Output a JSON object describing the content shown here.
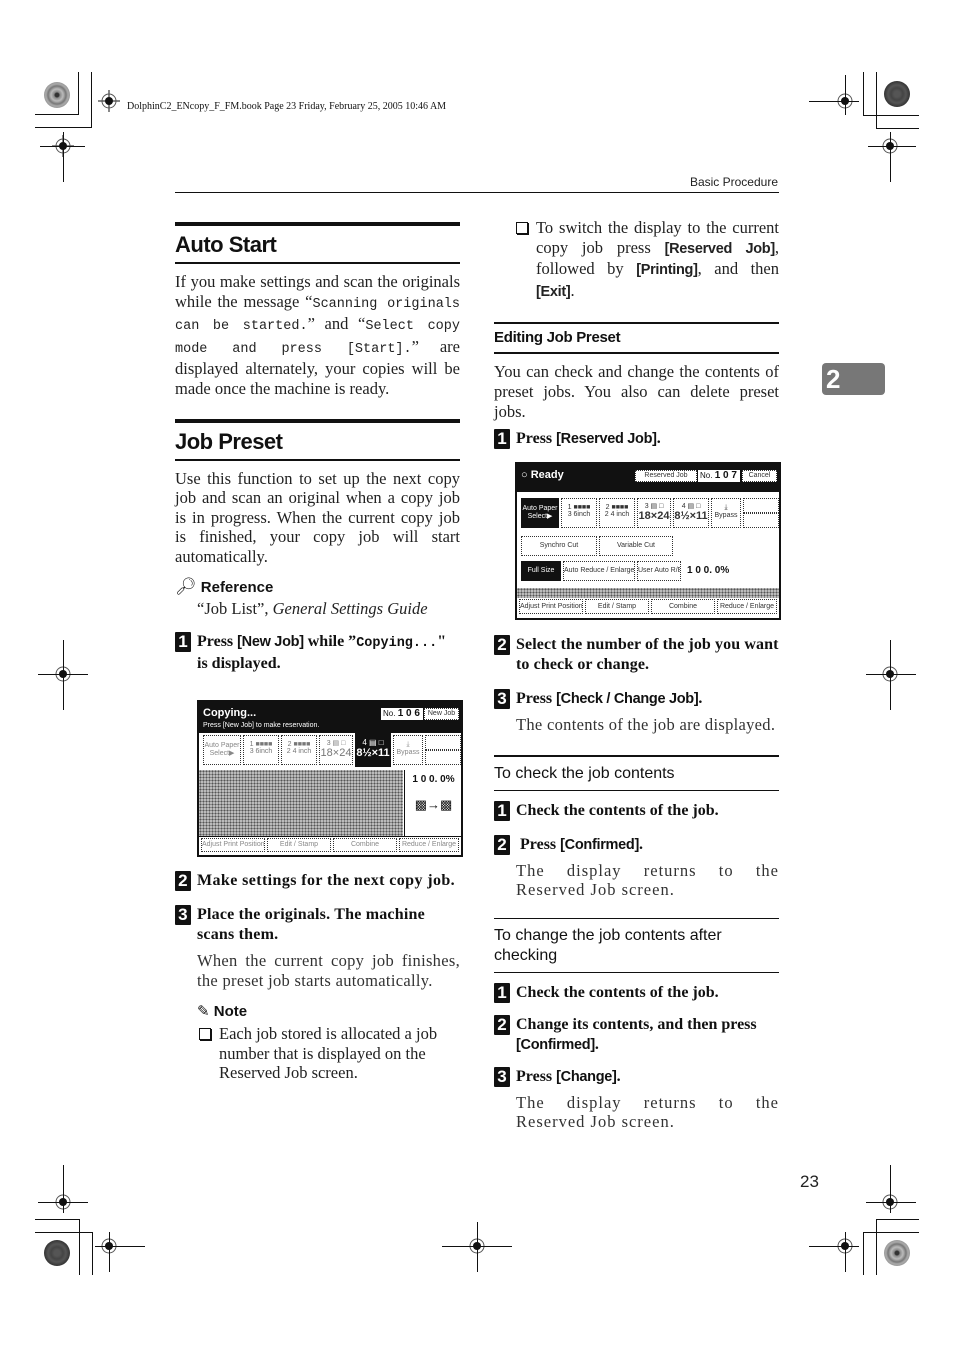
{
  "print_marks": {
    "book_info": "DolphinC2_ENcopy_F_FM.book  Page 23  Friday, February 25, 2005  10:46 AM"
  },
  "header": {
    "running_head": "Basic Procedure"
  },
  "chapter_tab": "2",
  "page_number": "23",
  "left_column": {
    "auto_start": {
      "title": "Auto Start",
      "body_1": "If you make settings and scan the originals while the message “",
      "msg_1": "Scanning originals can be started.",
      "body_2": "” and “",
      "msg_2": "Select copy mode and press [Start].",
      "body_3": "” are displayed alternately, your copies will be made once the machine is ready."
    },
    "job_preset": {
      "title": "Job Preset",
      "body": "Use this function to set up the next copy job and scan an original when a copy job is in progress. When the current copy job is finished, your copy job will start automatically.",
      "reference_label": "Reference",
      "reference_text_1": "“Job List”, ",
      "reference_text_2": "General Settings Guide",
      "steps": [
        {
          "num": "1",
          "pre": "Press ",
          "key": "[New Job]",
          "mid": " while ”",
          "mono": "Copying...",
          "post": "\" is displayed."
        },
        {
          "num": "2",
          "text": "Make settings for the next copy job."
        },
        {
          "num": "3",
          "text": "Place the originals. The machine scans them.",
          "sub": "When the current copy job finishes, the preset job starts automatically."
        }
      ],
      "note_label": "Note",
      "note_item": "Each job stored is allocated a job number that is displayed on the Reserved Job screen."
    },
    "screen_copying": {
      "status": "Copying...",
      "message": "Press [New Job] to make reservation.",
      "job_no_label": "No.",
      "job_no": "1 0 6",
      "new_job_button": "New Job",
      "paper_buttons": [
        {
          "line1": "Auto Paper",
          "line2": "Select▶"
        },
        {
          "line1": "1 ■■■■",
          "line2": "3 6inch"
        },
        {
          "line1": "2 ■■■■",
          "line2": "2 4 inch"
        },
        {
          "line1": "3 ▤ □",
          "line2": "18×24"
        },
        {
          "line1": "4 ▤ □",
          "line2": "8½×11"
        },
        {
          "line1": "⤓",
          "line2": "Bypass"
        }
      ],
      "ratio": "1 0 0. 0%",
      "bottom_buttons": [
        "Adjust Print Position",
        "Edit / Stamp",
        "Combine",
        "Reduce / Enlarge"
      ]
    }
  },
  "right_column": {
    "tip": {
      "pre": "To switch the display to the current copy job press ",
      "key1": "[Reserved Job]",
      "mid1": ", followed by ",
      "key2": "[Printing]",
      "mid2": ", and then ",
      "key3": "[Exit]",
      "post": "."
    },
    "editing": {
      "title": "Editing Job Preset",
      "body": "You can check and change the contents of preset jobs. You also can delete preset jobs.",
      "step1": {
        "num": "1",
        "pre": "Press ",
        "key": "[Reserved Job]",
        "post": "."
      },
      "step2": {
        "num": "2",
        "text": "Select the number of the job you want to check or change."
      },
      "step3": {
        "num": "3",
        "pre": "Press ",
        "key": "[Check / Change Job]",
        "post": ".",
        "sub": "The contents of the job are displayed."
      }
    },
    "screen_ready": {
      "status": "Ready",
      "reserved_job_button": "Reserved Job",
      "job_no_label": "No.",
      "job_no": "1 0 7",
      "cancel_button": "Cancel",
      "paper_buttons": [
        {
          "line1": "Auto Paper",
          "line2": "Select▶"
        },
        {
          "line1": "1 ■■■■",
          "line2": "3 6inch"
        },
        {
          "line1": "2 ■■■■",
          "line2": "2 4 inch"
        },
        {
          "line1": "3 ▤ □",
          "line2": "18×24"
        },
        {
          "line1": "4 ▤ □",
          "line2": "8½×11"
        },
        {
          "line1": "⤓",
          "line2": "Bypass"
        }
      ],
      "cut_buttons": [
        "Synchro Cut",
        "Variable Cut"
      ],
      "size_buttons": [
        "Full Size",
        "Auto Reduce / Enlarge",
        "User Auto R/E"
      ],
      "ratio": "1 0 0. 0%",
      "bottom_buttons": [
        "Adjust Print Position",
        "Edit / Stamp",
        "Combine",
        "Reduce / Enlarge"
      ]
    },
    "check": {
      "title": "To check the job contents",
      "step1": {
        "num": "1",
        "text": "Check the contents of the job."
      },
      "step2": {
        "num": "2",
        "pre": "Press ",
        "key": "[Confirmed]",
        "post": ".",
        "sub": "The display returns to the Reserved Job screen."
      }
    },
    "change": {
      "title": "To change the job contents after checking",
      "step1": {
        "num": "1",
        "text": "Check the contents of the job."
      },
      "step2": {
        "num": "2",
        "pre": "Change its contents, and then press ",
        "key": "[Confirmed]",
        "post": "."
      },
      "step3": {
        "num": "3",
        "pre": "Press ",
        "key": "[Change]",
        "post": ".",
        "sub": "The display returns to the Reserved Job screen."
      }
    }
  }
}
